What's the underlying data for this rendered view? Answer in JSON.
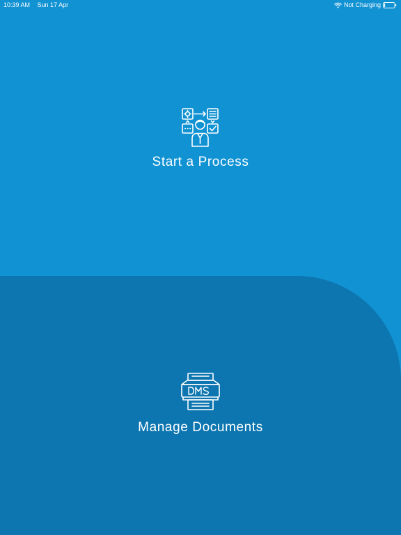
{
  "status_bar": {
    "time": "10:39 AM",
    "date": "Sun 17 Apr",
    "charging": "Not Charging",
    "battery_level": 0.1
  },
  "menu": {
    "process": {
      "label": "Start a Process",
      "icon": "process-workflow-icon"
    },
    "documents": {
      "label": "Manage Documents",
      "icon": "dms-icon"
    }
  },
  "colors": {
    "top_background": "#1192d3",
    "bottom_background": "#0d76b0",
    "foreground": "#ffffff"
  }
}
